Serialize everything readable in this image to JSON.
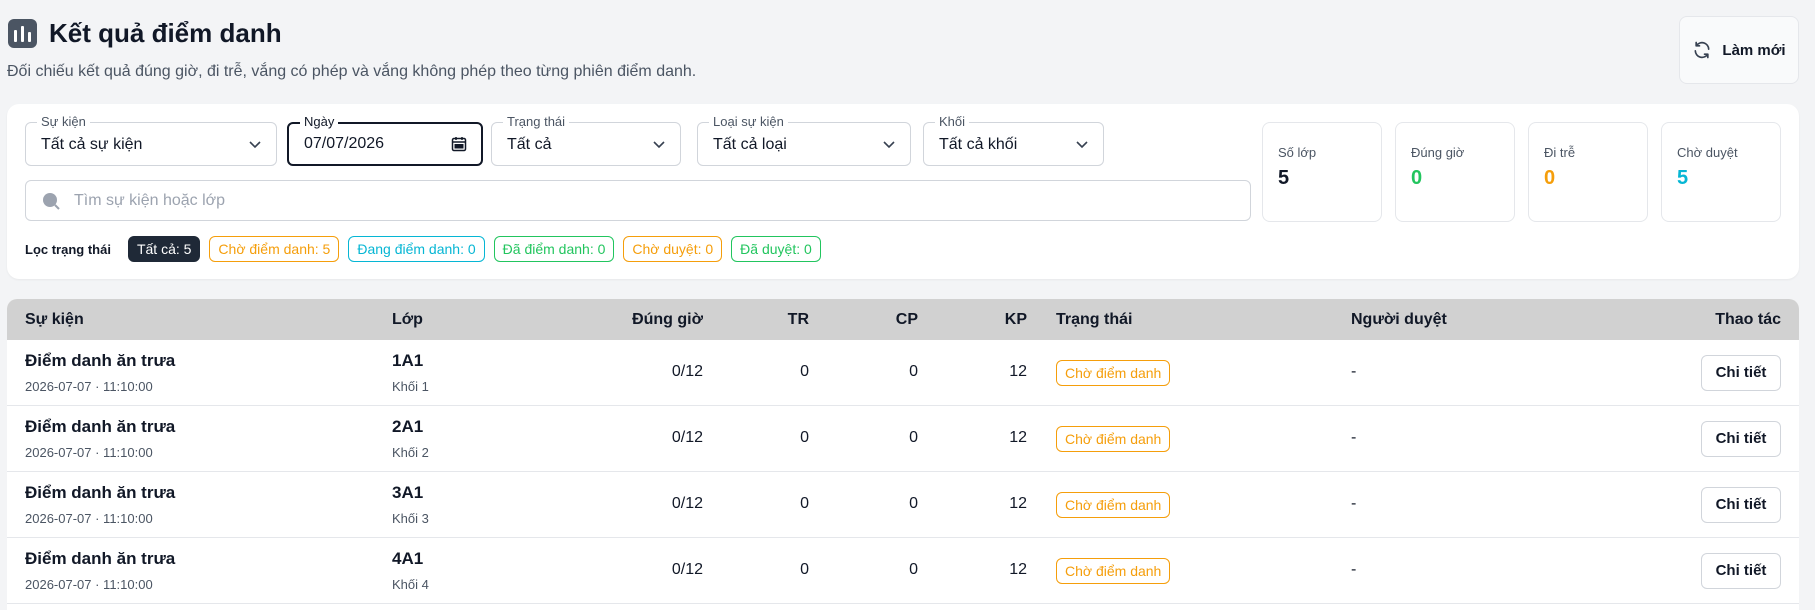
{
  "header": {
    "title": "Kết quả điểm danh",
    "subtitle": "Đối chiếu kết quả đúng giờ, đi trễ, vắng có phép và vắng không phép theo từng phiên điểm danh.",
    "refresh_label": "Làm mới"
  },
  "filters": {
    "event": {
      "label": "Sự kiện",
      "value": "Tất cả sự kiện"
    },
    "date": {
      "label": "Ngày",
      "value": "07/07/2026"
    },
    "status": {
      "label": "Trạng thái",
      "value": "Tất cả"
    },
    "event_type": {
      "label": "Loại sự kiện",
      "value": "Tất cả loại"
    },
    "grade": {
      "label": "Khối",
      "value": "Tất cả khối"
    },
    "search_placeholder": "Tìm sự kiện hoặc lớp"
  },
  "status_filter": {
    "label": "Lọc trạng thái",
    "chips": [
      {
        "text": "Tất cả: 5",
        "color": "#111827",
        "active": true
      },
      {
        "text": "Chờ điểm danh: 5",
        "color": "#f59e0b"
      },
      {
        "text": "Đang điểm danh: 0",
        "color": "#06b6d4"
      },
      {
        "text": "Đã điểm danh: 0",
        "color": "#22c55e"
      },
      {
        "text": "Chờ duyệt: 0",
        "color": "#f59e0b"
      },
      {
        "text": "Đã duyệt: 0",
        "color": "#22c55e"
      }
    ]
  },
  "stats": [
    {
      "label": "Số lớp",
      "value": "5",
      "color": "#111827"
    },
    {
      "label": "Đúng giờ",
      "value": "0",
      "color": "#22c55e"
    },
    {
      "label": "Đi trễ",
      "value": "0",
      "color": "#f59e0b"
    },
    {
      "label": "Chờ duyệt",
      "value": "5",
      "color": "#06b6d4"
    }
  ],
  "table": {
    "columns": {
      "event": "Sự kiện",
      "class": "Lớp",
      "on_time": "Đúng giờ",
      "tr": "TR",
      "cp": "CP",
      "kp": "KP",
      "status": "Trạng thái",
      "approver": "Người duyệt",
      "actions": "Thao tác"
    },
    "rows": [
      {
        "event": "Điểm danh ăn trưa",
        "time": "2026-07-07 · 11:10:00",
        "class": "1A1",
        "grade": "Khối 1",
        "on_time": "0/12",
        "tr": "0",
        "cp": "0",
        "kp": "12",
        "status": "Chờ điểm danh",
        "approver": "-",
        "action": "Chi tiết"
      },
      {
        "event": "Điểm danh ăn trưa",
        "time": "2026-07-07 · 11:10:00",
        "class": "2A1",
        "grade": "Khối 2",
        "on_time": "0/12",
        "tr": "0",
        "cp": "0",
        "kp": "12",
        "status": "Chờ điểm danh",
        "approver": "-",
        "action": "Chi tiết"
      },
      {
        "event": "Điểm danh ăn trưa",
        "time": "2026-07-07 · 11:10:00",
        "class": "3A1",
        "grade": "Khối 3",
        "on_time": "0/12",
        "tr": "0",
        "cp": "0",
        "kp": "12",
        "status": "Chờ điểm danh",
        "approver": "-",
        "action": "Chi tiết"
      },
      {
        "event": "Điểm danh ăn trưa",
        "time": "2026-07-07 · 11:10:00",
        "class": "4A1",
        "grade": "Khối 4",
        "on_time": "0/12",
        "tr": "0",
        "cp": "0",
        "kp": "12",
        "status": "Chờ điểm danh",
        "approver": "-",
        "action": "Chi tiết"
      }
    ]
  }
}
